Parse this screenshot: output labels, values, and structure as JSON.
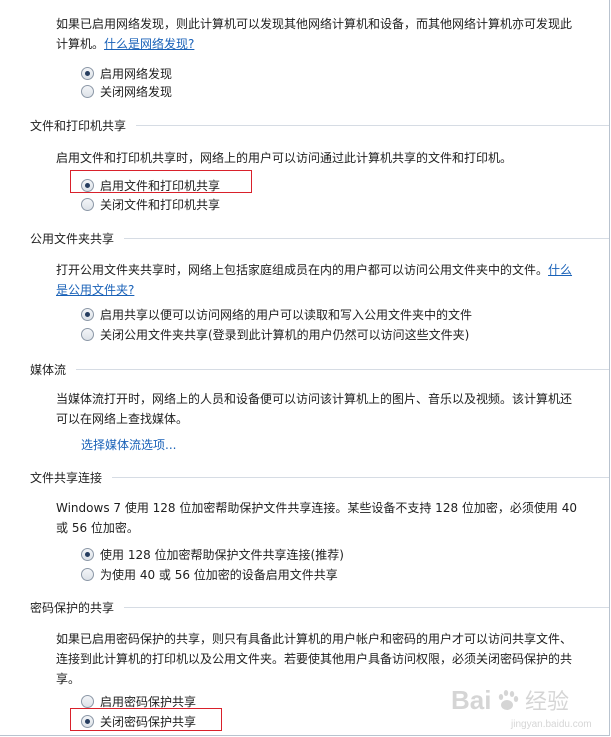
{
  "discovery": {
    "desc_line1": "如果已启用网络发现，则此计算机可以发现其他网络计算机和设备，而其他网络计算机亦可发现此",
    "desc_line2": "计算机。",
    "link": "什么是网络发现?",
    "opt_on": "启用网络发现",
    "opt_off": "关闭网络发现"
  },
  "printer": {
    "title": "文件和打印机共享",
    "desc": "启用文件和打印机共享时，网络上的用户可以访问通过此计算机共享的文件和打印机。",
    "opt_on": "启用文件和打印机共享",
    "opt_off": "关闭文件和打印机共享"
  },
  "public": {
    "title": "公用文件夹共享",
    "desc": "打开公用文件夹共享时，网络上包括家庭组成员在内的用户都可以访问公用文件夹中的文件。",
    "link_part1": "什么",
    "link_part2": "是公用文件夹?",
    "opt_on": "启用共享以便可以访问网络的用户可以读取和写入公用文件夹中的文件",
    "opt_off": "关闭公用文件夹共享(登录到此计算机的用户仍然可以访问这些文件夹)"
  },
  "media": {
    "title": "媒体流",
    "desc_line1": "当媒体流打开时，网络上的人员和设备便可以访问该计算机上的图片、音乐以及视频。该计算机还",
    "desc_line2": "可以在网络上查找媒体。",
    "link": "选择媒体流选项..."
  },
  "connection": {
    "title": "文件共享连接",
    "desc_line1": "Windows 7 使用 128 位加密帮助保护文件共享连接。某些设备不支持 128 位加密，必须使用 40",
    "desc_line2": "或 56 位加密。",
    "opt_128": "使用 128 位加密帮助保护文件共享连接(推荐)",
    "opt_40": "为使用 40 或 56 位加密的设备启用文件共享"
  },
  "password": {
    "title": "密码保护的共享",
    "desc_line1": "如果已启用密码保护的共享，则只有具备此计算机的用户帐户和密码的用户才可以访问共享文件、",
    "desc_line2": "连接到此计算机的打印机以及公用文件夹。若要使其他用户具备访问权限，必须关闭密码保护的共",
    "desc_line3": "享。",
    "opt_on": "启用密码保护共享",
    "opt_off": "关闭密码保护共享"
  },
  "watermark": {
    "brand": "Bai",
    "brand2": "经验",
    "url": "jingyan.baidu.com"
  },
  "colors": {
    "highlight": "#d9212b",
    "link": "#1a62b8"
  }
}
